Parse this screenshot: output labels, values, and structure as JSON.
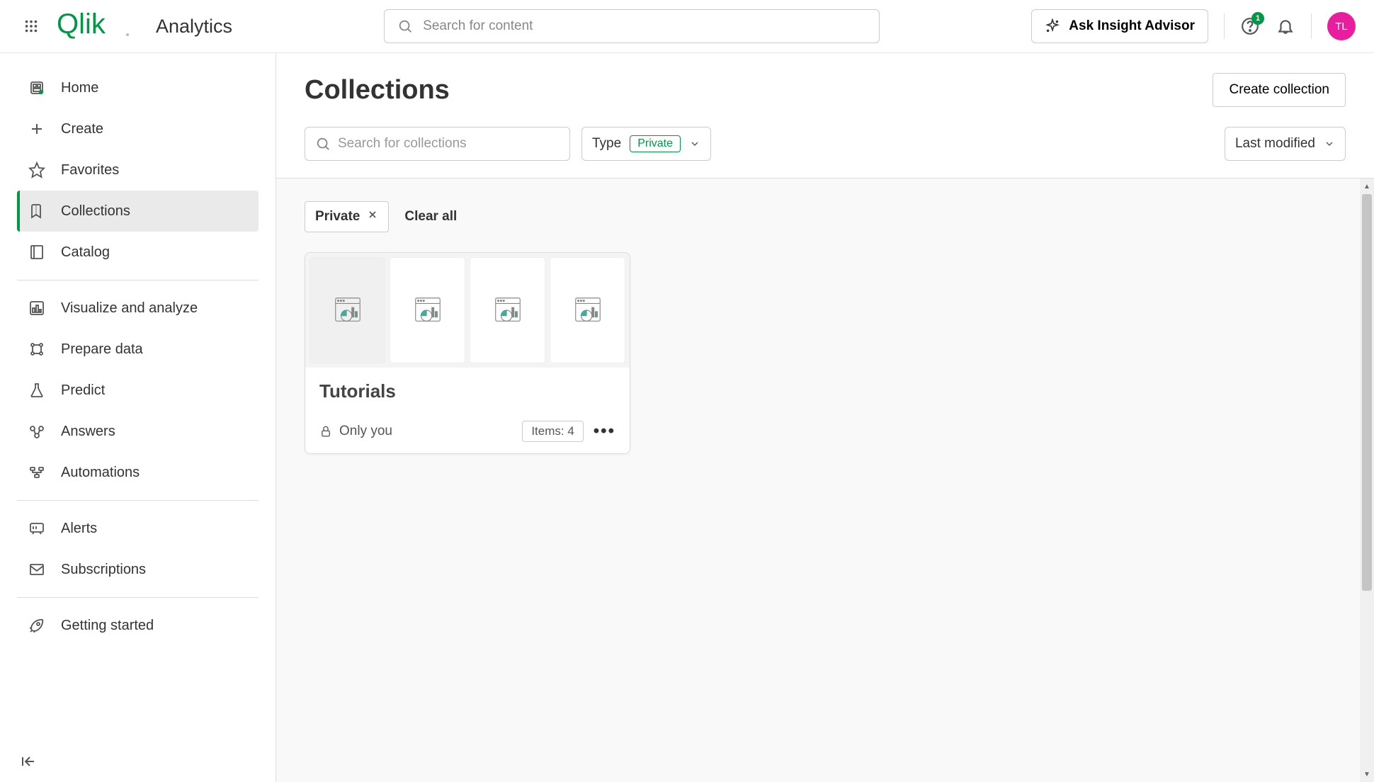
{
  "header": {
    "app_title": "Analytics",
    "search_placeholder": "Search for content",
    "insight_label": "Ask Insight Advisor",
    "help_badge": "1",
    "avatar_initials": "TL"
  },
  "sidebar": {
    "items": [
      {
        "label": "Home"
      },
      {
        "label": "Create"
      },
      {
        "label": "Favorites"
      },
      {
        "label": "Collections"
      },
      {
        "label": "Catalog"
      },
      {
        "label": "Visualize and analyze"
      },
      {
        "label": "Prepare data"
      },
      {
        "label": "Predict"
      },
      {
        "label": "Answers"
      },
      {
        "label": "Automations"
      },
      {
        "label": "Alerts"
      },
      {
        "label": "Subscriptions"
      },
      {
        "label": "Getting started"
      }
    ]
  },
  "page": {
    "title": "Collections",
    "create_label": "Create collection",
    "search_placeholder": "Search for collections",
    "type_label": "Type",
    "type_value": "Private",
    "sort_label": "Last modified"
  },
  "chips": {
    "private_label": "Private",
    "clear_all_label": "Clear all"
  },
  "card": {
    "title": "Tutorials",
    "visibility": "Only you",
    "items_label": "Items: 4"
  }
}
